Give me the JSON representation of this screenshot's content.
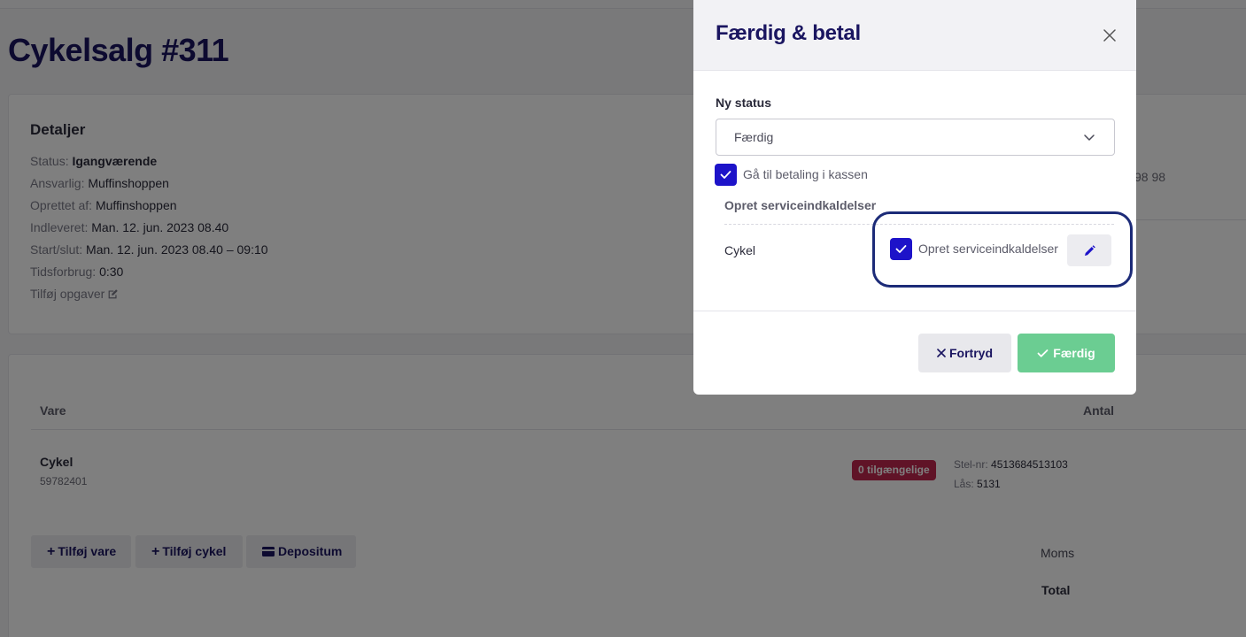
{
  "page": {
    "title": "Cykelsalg #311",
    "details": {
      "heading": "Detaljer",
      "rows": [
        {
          "key": "Status:",
          "value": "Igangværende"
        },
        {
          "key": "Ansvarlig:",
          "value": "Muffinshoppen"
        },
        {
          "key": "Oprettet af:",
          "value": "Muffinshoppen"
        },
        {
          "key": "Indleveret:",
          "value": "Man. 12. jun. 2023 08.40"
        },
        {
          "key": "Start/slut:",
          "value": "Man. 12. jun. 2023 08.40 – 09:10"
        },
        {
          "key": "Tidsforbrug:",
          "value": "0:30"
        }
      ],
      "add_tasks": "Tilføj opgaver",
      "right_partial": "98 98"
    },
    "items_table": {
      "col_vare": "Vare",
      "col_antal": "Antal",
      "rows": [
        {
          "name": "Cykel",
          "sku": "59782401",
          "badge": "0 tilgængelige",
          "frame_label": "Stel-nr:",
          "frame_value": "4513684513103",
          "lock_label": "Lås:",
          "lock_value": "5131"
        }
      ]
    },
    "buttons": {
      "add_item": "Tilføj vare",
      "add_bike": "Tilføj cykel",
      "deposit": "Depositum"
    },
    "summary": {
      "moms": "Moms",
      "total": "Total"
    }
  },
  "modal": {
    "title": "Færdig & betal",
    "status_label": "Ny status",
    "status_value": "Færdig",
    "pay_checkbox_label": "Gå til betaling i kassen",
    "service_section": "Opret serviceindkaldelser",
    "service_item": "Cykel",
    "service_checkbox_label": "Opret serviceindkaldelser",
    "cancel_label": "Fortryd",
    "done_label": "Færdig"
  },
  "colors": {
    "brand": "#1a1560",
    "checkbox": "#1d13c9",
    "success": "#6bcd92",
    "danger_badge": "#c0274e",
    "highlight": "#1c2b78"
  }
}
